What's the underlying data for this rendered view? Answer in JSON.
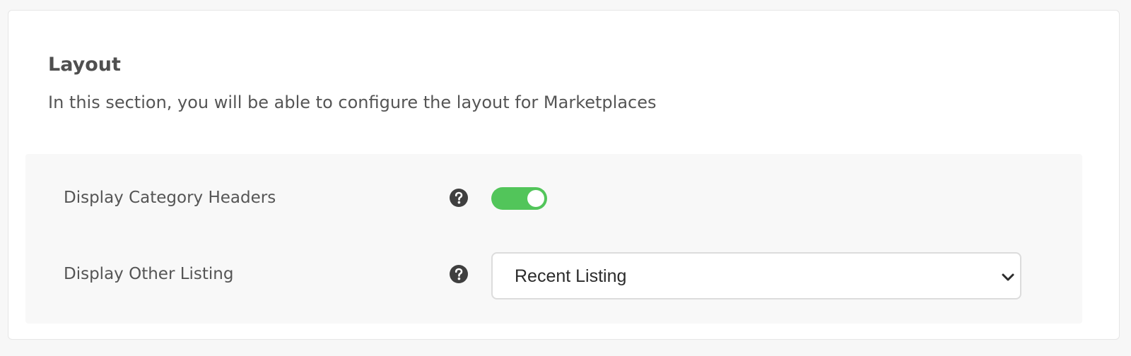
{
  "section": {
    "title": "Layout",
    "description": "In this section, you will be able to configure the layout for Marketplaces"
  },
  "settings": [
    {
      "label": "Display Category Headers",
      "help_icon": "question-circle-icon",
      "control": "toggle",
      "enabled": true
    },
    {
      "label": "Display Other Listing",
      "help_icon": "question-circle-icon",
      "control": "select",
      "selected": "Recent Listing",
      "dropdown_icon": "chevron-down-icon"
    }
  ],
  "colors": {
    "toggle_on": "#52c55a",
    "icon": "#3f3f3f",
    "panel_bg": "#f8f8f8"
  }
}
